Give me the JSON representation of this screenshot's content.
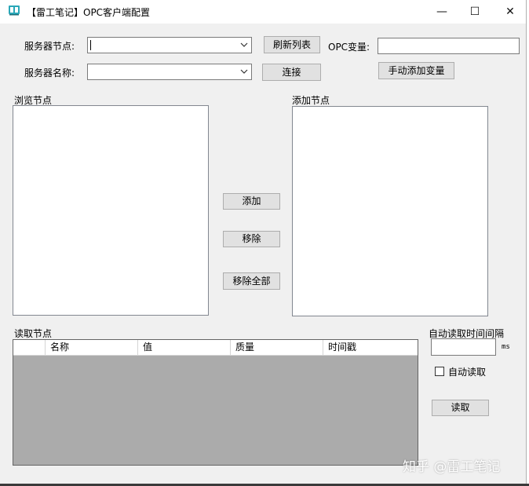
{
  "window": {
    "title": "【雷工笔记】OPC客户端配置",
    "minimize_glyph": "—",
    "maximize_glyph": "☐",
    "close_glyph": "✕"
  },
  "server": {
    "node_label": "服务器节点:",
    "node_value": "",
    "name_label": "服务器名称:",
    "name_value": "",
    "refresh_button": "刷新列表",
    "connect_button": "连接"
  },
  "opc_var": {
    "label": "OPC变量:",
    "value": "",
    "manual_add_button": "手动添加变量"
  },
  "browse": {
    "label": "浏览节点"
  },
  "added": {
    "label": "添加节点"
  },
  "transfer": {
    "add_button": "添加",
    "remove_button": "移除",
    "remove_all_button": "移除全部"
  },
  "read_nodes": {
    "label": "读取节点",
    "columns": [
      "",
      "名称",
      "值",
      "质量",
      "时间戳"
    ]
  },
  "auto_read": {
    "interval_label": "自动读取时间间隔",
    "interval_value": "",
    "unit": "ms",
    "checkbox_label": "自动读取",
    "checked": false,
    "read_button": "读取"
  },
  "watermark": "知乎 @雷工笔记",
  "icons": {
    "app": "book-icon",
    "dropdown": "chevron-down-icon"
  },
  "colors": {
    "window_bg": "#f0f0f0",
    "button_bg": "#e1e1e1",
    "grid_bg": "#ababab"
  }
}
